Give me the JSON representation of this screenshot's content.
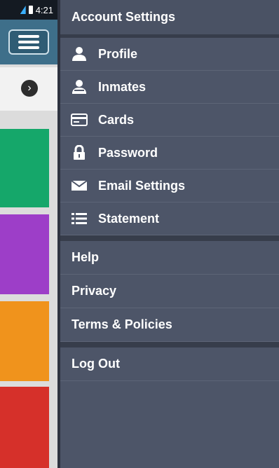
{
  "status_bar": {
    "time": "4:21"
  },
  "drawer": {
    "header": "Account Settings",
    "account_items": [
      {
        "label": "Profile",
        "icon": "user-icon"
      },
      {
        "label": "Inmates",
        "icon": "inmate-icon"
      },
      {
        "label": "Cards",
        "icon": "card-icon"
      },
      {
        "label": "Password",
        "icon": "lock-icon"
      },
      {
        "label": "Email Settings",
        "icon": "envelope-icon"
      },
      {
        "label": "Statement",
        "icon": "list-icon"
      }
    ],
    "info_items": [
      {
        "label": "Help"
      },
      {
        "label": "Privacy"
      },
      {
        "label": "Terms & Policies"
      }
    ],
    "logout_label": "Log Out"
  },
  "colors": {
    "drawer_bg": "#4d5568",
    "separator": "#373d4b",
    "tile_green": "#15a76a",
    "tile_purple": "#9d3ec8",
    "tile_orange": "#f0931c",
    "tile_red": "#d6302a"
  }
}
